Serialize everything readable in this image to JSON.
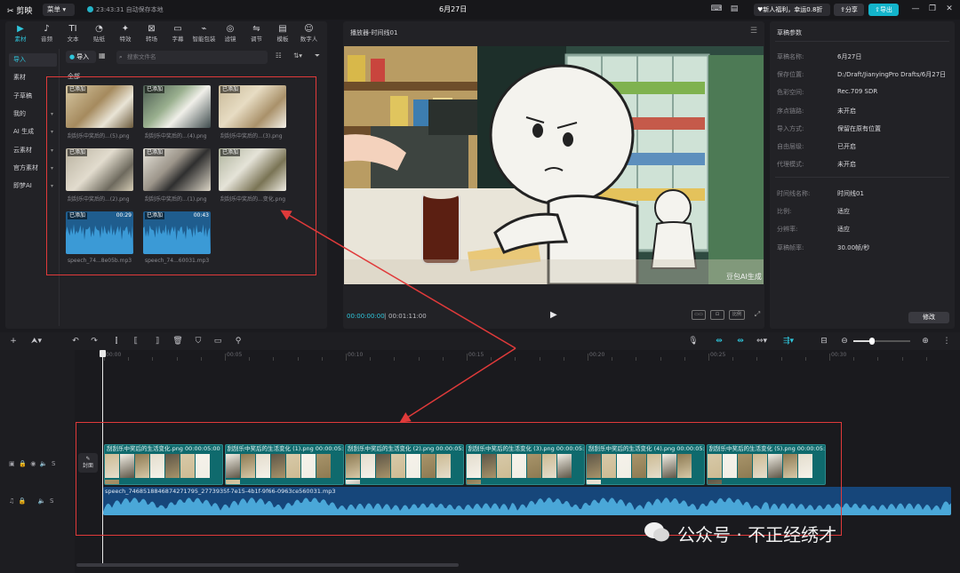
{
  "app": {
    "name": "剪映",
    "menu_label": "菜单",
    "save_status": "23:43:31 自动保存本地",
    "title": "6月27日",
    "promo": "新人福利，幸运0.8折",
    "share_label": "分享",
    "export_label": "导出"
  },
  "media_tabs": [
    {
      "glyph": "▶",
      "label": "素材"
    },
    {
      "glyph": "♪",
      "label": "音频"
    },
    {
      "glyph": "TI",
      "label": "文本"
    },
    {
      "glyph": "◔",
      "label": "贴纸"
    },
    {
      "glyph": "✦",
      "label": "特效"
    },
    {
      "glyph": "⊠",
      "label": "转场"
    },
    {
      "glyph": "▭",
      "label": "字幕"
    },
    {
      "glyph": "⌁",
      "label": "智能包装"
    },
    {
      "glyph": "◎",
      "label": "滤镜"
    },
    {
      "glyph": "⇋",
      "label": "调节"
    },
    {
      "glyph": "▤",
      "label": "模板"
    },
    {
      "glyph": "☺",
      "label": "数字人"
    }
  ],
  "sidebar": [
    {
      "label": "导入",
      "active": true,
      "chevron": false
    },
    {
      "label": "素材",
      "active": false,
      "chevron": false
    },
    {
      "label": "子草稿",
      "active": false,
      "chevron": false
    },
    {
      "label": "我的",
      "active": false,
      "chevron": true
    },
    {
      "label": "AI 生成",
      "active": false,
      "chevron": true
    },
    {
      "label": "云素材",
      "active": false,
      "chevron": true
    },
    {
      "label": "官方素材",
      "active": false,
      "chevron": true
    },
    {
      "label": "即梦AI",
      "active": false,
      "chevron": true
    }
  ],
  "media": {
    "import_label": "导入",
    "search_placeholder": "搜索文件名",
    "section_label": "全部",
    "items": [
      {
        "tag": "已添加",
        "name": "刮刮乐中奖后的...(5).png",
        "duration": "",
        "kind": "img1"
      },
      {
        "tag": "已添加",
        "name": "刮刮乐中奖后的...(4).png",
        "duration": "",
        "kind": "img2"
      },
      {
        "tag": "已添加",
        "name": "刮刮乐中奖后的...(3).png",
        "duration": "",
        "kind": "img3"
      },
      {
        "tag": "已添加",
        "name": "刮刮乐中奖后的...(2).png",
        "duration": "",
        "kind": "img4"
      },
      {
        "tag": "已添加",
        "name": "刮刮乐中奖后的...(1).png",
        "duration": "",
        "kind": "img5"
      },
      {
        "tag": "已添加",
        "name": "刮刮乐中奖后的...变化.png",
        "duration": "",
        "kind": "img6"
      },
      {
        "tag": "已添加",
        "name": "speech_74...8e05b.mp3",
        "duration": "00:29",
        "kind": "audio"
      },
      {
        "tag": "已添加",
        "name": "speech_74...60031.mp3",
        "duration": "00:43",
        "kind": "audio"
      }
    ]
  },
  "player": {
    "title": "播放器-时间线01",
    "current_time": "00:00:00:00",
    "total_time": "00:01:11:00",
    "watermark": "豆包AI生成",
    "buttons": [
      "▭▭",
      "⊡",
      "比例",
      "⤢"
    ]
  },
  "props": {
    "title": "草稿参数",
    "group1": [
      {
        "k": "草稿名称:",
        "v": "6月27日"
      },
      {
        "k": "保存位置:",
        "v": "D:/Draft/JianyingPro Drafts/6月27日"
      },
      {
        "k": "色彩空间:",
        "v": "Rec.709 SDR"
      },
      {
        "k": "序点链路:",
        "v": "未开启"
      },
      {
        "k": "导入方式:",
        "v": "保留在原有位置"
      },
      {
        "k": "自由层级:",
        "v": "已开启"
      },
      {
        "k": "代理模式:",
        "v": "未开启"
      }
    ],
    "group2": [
      {
        "k": "时间线名称:",
        "v": "时间线01"
      },
      {
        "k": "比例:",
        "v": "适应"
      },
      {
        "k": "分辨率:",
        "v": "适应"
      },
      {
        "k": "草稿帧率:",
        "v": "30.00帧/秒"
      }
    ],
    "modify_label": "修改"
  },
  "timeline": {
    "ticks": [
      "00:00",
      "00:05",
      "00:10",
      "00:15",
      "00:20",
      "00:25",
      "00:30"
    ],
    "cover_label": "封面",
    "video_clips": [
      {
        "name": "刮刮乐中奖后的生活变化.png",
        "duration": "00:00:05:00"
      },
      {
        "name": "刮刮乐中奖后的生活变化 (1).png",
        "duration": "00:00:05:00"
      },
      {
        "name": "刮刮乐中奖后的生活变化 (2).png",
        "duration": "00:00:05:00"
      },
      {
        "name": "刮刮乐中奖后的生活变化 (3).png",
        "duration": "00:00:05:00"
      },
      {
        "name": "刮刮乐中奖后的生活变化 (4).png",
        "duration": "00:00:05:00"
      },
      {
        "name": "刮刮乐中奖后的生活变化 (5).png",
        "duration": "00:00:05:00"
      }
    ],
    "audio_clip": "speech_7468518846874271795_2773935f-7e15-4b1f-9f66-0963ce560031.mp3"
  },
  "watermark_text": "公众号 · 不正经绣才",
  "annotation_color": "#e03a3a"
}
